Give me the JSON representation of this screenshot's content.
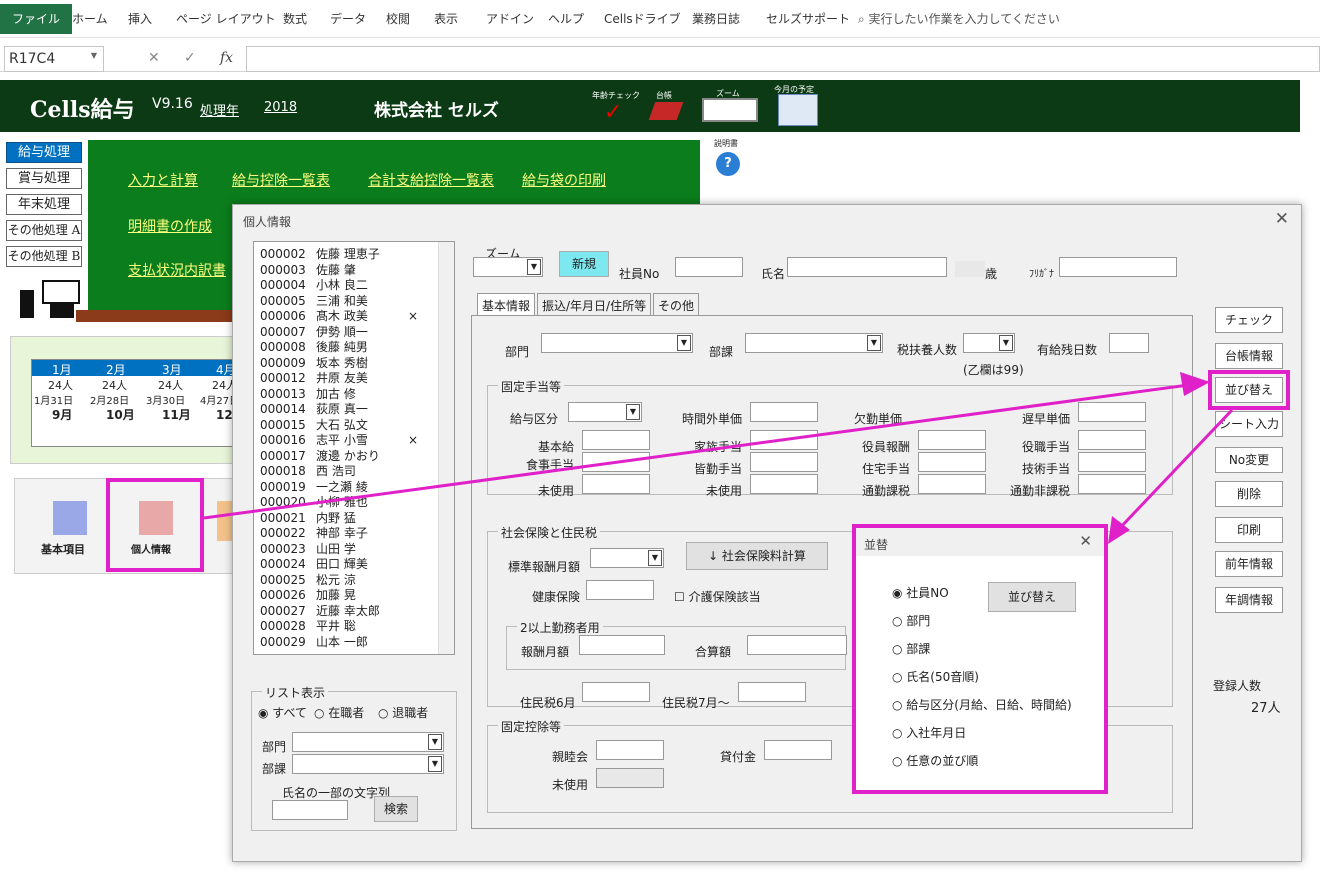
{
  "ribbon": {
    "tabs": [
      "ファイル",
      "ホーム",
      "挿入",
      "ページ レイアウト",
      "数式",
      "データ",
      "校閲",
      "表示",
      "アドイン",
      "ヘルプ",
      "Cellsドライブ",
      "業務日誌",
      "セルズサポート"
    ],
    "search": "実行したい作業を入力してください"
  },
  "formula": {
    "cell": "R17C4",
    "fx": "fx"
  },
  "header": {
    "app": "Cells給与",
    "ver": "V9.16",
    "year_label": "処理年",
    "year": "2018",
    "company": "株式会社 セルズ",
    "age_check": "年齢チェック",
    "ledger": "台帳",
    "zoom": "ズーム",
    "monthly": "今月の予定",
    "manual": "説明書"
  },
  "side": [
    "給与処理",
    "賞与処理",
    "年末処理",
    "その他処理 A",
    "その他処理 B"
  ],
  "menu": [
    "入力と計算",
    "給与控除一覧表",
    "合計支給控除一覧表",
    "給与袋の印刷",
    "明細書の作成",
    "支払状況内訳書"
  ],
  "calendar": {
    "months1": [
      "1月",
      "2月",
      "3月",
      "4月"
    ],
    "counts": [
      "24人",
      "24人",
      "24人",
      "24人"
    ],
    "dates": [
      "1月31日",
      "2月28日",
      "3月30日",
      "4月27日"
    ],
    "months2": [
      "9月",
      "10月",
      "11月",
      "12月"
    ]
  },
  "icons": {
    "basic": "基本項目",
    "personal": "個人情報"
  },
  "dialog": {
    "title": "個人情報",
    "employees": [
      [
        "000002",
        "佐藤 理恵子",
        ""
      ],
      [
        "000003",
        "佐藤 肇",
        ""
      ],
      [
        "000004",
        "小林 良二",
        ""
      ],
      [
        "000005",
        "三浦 和美",
        ""
      ],
      [
        "000006",
        "髙木 政美",
        "×"
      ],
      [
        "000007",
        "伊勢 順一",
        ""
      ],
      [
        "000008",
        "後藤 純男",
        ""
      ],
      [
        "000009",
        "坂本 秀樹",
        ""
      ],
      [
        "000012",
        "井原 友美",
        ""
      ],
      [
        "000013",
        "加古 修",
        ""
      ],
      [
        "000014",
        "荻原 真一",
        ""
      ],
      [
        "000015",
        "大石 弘文",
        ""
      ],
      [
        "000016",
        "志平 小雪",
        "×"
      ],
      [
        "000017",
        "渡邊 かおり",
        ""
      ],
      [
        "000018",
        "西 浩司",
        ""
      ],
      [
        "000019",
        "一之瀬 綾",
        ""
      ],
      [
        "000020",
        "小柳 雅也",
        ""
      ],
      [
        "000021",
        "内野 猛",
        ""
      ],
      [
        "000022",
        "神部 幸子",
        ""
      ],
      [
        "000023",
        "山田 学",
        ""
      ],
      [
        "000024",
        "田口 輝美",
        ""
      ],
      [
        "000025",
        "松元 涼",
        ""
      ],
      [
        "000026",
        "加藤 晃",
        ""
      ],
      [
        "000027",
        "近藤 幸太郎",
        ""
      ],
      [
        "000028",
        "平井 聡",
        ""
      ],
      [
        "000029",
        "山本 一郎",
        ""
      ]
    ],
    "list_display": "リスト表示",
    "all": "すべて",
    "current": "在職者",
    "retired": "退職者",
    "dept": "部門",
    "section": "部課",
    "name_search": "氏名の一部の文字列",
    "search_btn": "検索",
    "zoom": "ズーム",
    "new_btn": "新規",
    "emp_no": "社員No",
    "name": "氏名",
    "age": "歳",
    "kana": "ﾌﾘｶﾞﾅ",
    "tabs": [
      "基本情報",
      "振込/年月日/住所等",
      "その他"
    ],
    "f_dept": "部門",
    "f_section": "部課",
    "dependents": "税扶養人数",
    "dep_note": "(乙欄は99)",
    "leave": "有給残日数",
    "fixed_allow": "固定手当等",
    "pay_type": "給与区分",
    "ot_rate": "時間外単価",
    "absent_rate": "欠勤単価",
    "early_rate": "遅早単価",
    "base": "基本給",
    "family": "家族手当",
    "officer": "役員報酬",
    "position": "役職手当",
    "meal": "食事手当",
    "attend": "皆勤手当",
    "housing": "住宅手当",
    "skill": "技術手当",
    "unused1": "未使用",
    "unused2": "未使用",
    "commute_tax": "通勤課税",
    "commute_free": "通勤非課税",
    "social": "社会保険と住民税",
    "std_pay": "標準報酬月額",
    "calc_btn": "↓ 社会保険料計算",
    "health": "健康保険",
    "care": "介護保険該当",
    "multi": "2以上勤務者用",
    "pay_month": "報酬月額",
    "total": "合算額",
    "res6": "住民税6月",
    "res7": "住民税7月～",
    "fixed_ded": "固定控除等",
    "social_club": "親睦会",
    "loan": "貸付金",
    "unused3": "未使用",
    "right_btns": [
      "チェック",
      "台帳情報",
      "並び替え",
      "シート入力",
      "No変更",
      "削除",
      "印刷",
      "前年情報",
      "年調情報"
    ],
    "reg_label": "登録人数",
    "reg_count": "27人"
  },
  "sort": {
    "title": "並替",
    "options": [
      "社員NO",
      "部門",
      "部課",
      "氏名(50音順)",
      "給与区分(月給、日給、時間給)",
      "入社年月日",
      "任意の並び順"
    ],
    "btn": "並び替え"
  }
}
